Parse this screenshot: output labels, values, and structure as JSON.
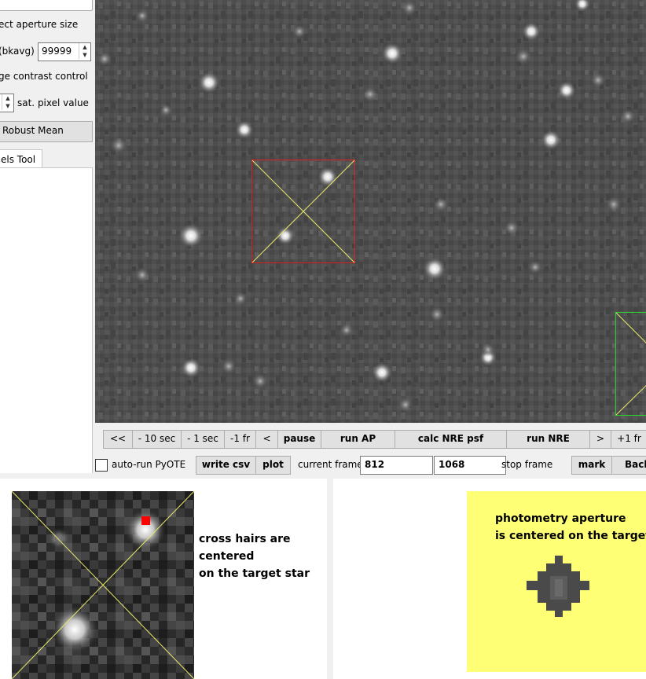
{
  "left_panel": {
    "aperture_label": "ect aperture size",
    "bkavg_label": "(bkavg)",
    "bkavg_value": "99999",
    "contrast_label": "ge contrast control",
    "sat_label": "sat. pixel value",
    "robust_mean_button": "Robust Mean",
    "tools_tab": "els Tool"
  },
  "controls": {
    "row1": [
      "<<",
      "- 10 sec",
      "- 1 sec",
      "-1 fr",
      "<",
      "pause",
      "run AP",
      "calc NRE psf",
      "run NRE",
      ">",
      "+1 fr"
    ],
    "auto_run_label": "auto-run PyOTE",
    "write_csv": "write csv",
    "plot": "plot",
    "current_frame_label": "current frame",
    "current_frame_value": "812",
    "stop_frame_value": "1068",
    "stop_frame_label": "stop frame",
    "mark": "mark",
    "back": "Back"
  },
  "notes": {
    "crosshair_lines": [
      "cross hairs are",
      "centered",
      "on the target star"
    ],
    "aperture_lines": [
      "photometry aperture",
      "is centered on the target"
    ]
  },
  "colors": {
    "target_box": "#e02020",
    "crosshair": "#e8e86a",
    "secondary_box": "#2ad12a",
    "highlight": "#ffff75",
    "star_marker": "#ff0000"
  }
}
